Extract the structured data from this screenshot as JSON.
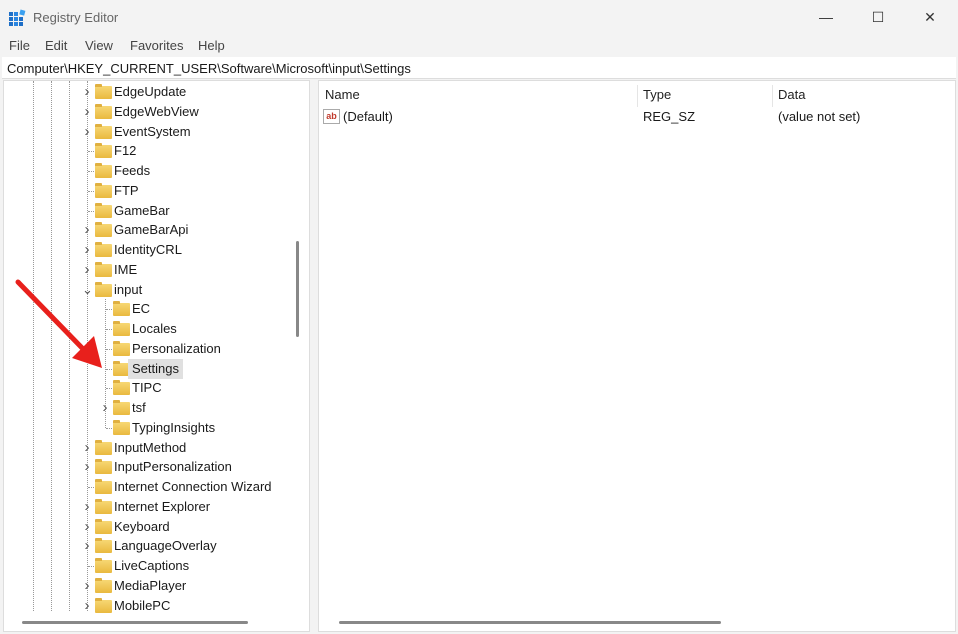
{
  "window": {
    "title": "Registry Editor",
    "minimize": "—",
    "maximize": "☐",
    "close": "✕"
  },
  "menu": [
    "File",
    "Edit",
    "View",
    "Favorites",
    "Help"
  ],
  "address": "Computer\\HKEY_CURRENT_USER\\Software\\Microsoft\\input\\Settings",
  "tree": [
    {
      "label": "EdgeUpdate",
      "level": 1,
      "expandable": true
    },
    {
      "label": "EdgeWebView",
      "level": 1,
      "expandable": true
    },
    {
      "label": "EventSystem",
      "level": 1,
      "expandable": true
    },
    {
      "label": "F12",
      "level": 1,
      "expandable": false
    },
    {
      "label": "Feeds",
      "level": 1,
      "expandable": false
    },
    {
      "label": "FTP",
      "level": 1,
      "expandable": false
    },
    {
      "label": "GameBar",
      "level": 1,
      "expandable": false
    },
    {
      "label": "GameBarApi",
      "level": 1,
      "expandable": true
    },
    {
      "label": "IdentityCRL",
      "level": 1,
      "expandable": true
    },
    {
      "label": "IME",
      "level": 1,
      "expandable": true
    },
    {
      "label": "input",
      "level": 1,
      "expandable": true,
      "expanded": true
    },
    {
      "label": "EC",
      "level": 2,
      "expandable": false
    },
    {
      "label": "Locales",
      "level": 2,
      "expandable": false
    },
    {
      "label": "Personalization",
      "level": 2,
      "expandable": false
    },
    {
      "label": "Settings",
      "level": 2,
      "expandable": false,
      "selected": true
    },
    {
      "label": "TIPC",
      "level": 2,
      "expandable": false
    },
    {
      "label": "tsf",
      "level": 2,
      "expandable": true
    },
    {
      "label": "TypingInsights",
      "level": 2,
      "expandable": false
    },
    {
      "label": "InputMethod",
      "level": 1,
      "expandable": true
    },
    {
      "label": "InputPersonalization",
      "level": 1,
      "expandable": true
    },
    {
      "label": "Internet Connection Wizard",
      "level": 1,
      "expandable": false
    },
    {
      "label": "Internet Explorer",
      "level": 1,
      "expandable": true
    },
    {
      "label": "Keyboard",
      "level": 1,
      "expandable": true
    },
    {
      "label": "LanguageOverlay",
      "level": 1,
      "expandable": true
    },
    {
      "label": "LiveCaptions",
      "level": 1,
      "expandable": false
    },
    {
      "label": "MediaPlayer",
      "level": 1,
      "expandable": true
    },
    {
      "label": "MobilePC",
      "level": 1,
      "expandable": true
    }
  ],
  "list": {
    "columns": [
      "Name",
      "Type",
      "Data"
    ],
    "rows": [
      {
        "name": "(Default)",
        "type": "REG_SZ",
        "data": "(value not set)",
        "icon": "ab"
      }
    ]
  },
  "colors": {
    "arrow": "#e8201c",
    "selected": "#e0e0e0"
  }
}
